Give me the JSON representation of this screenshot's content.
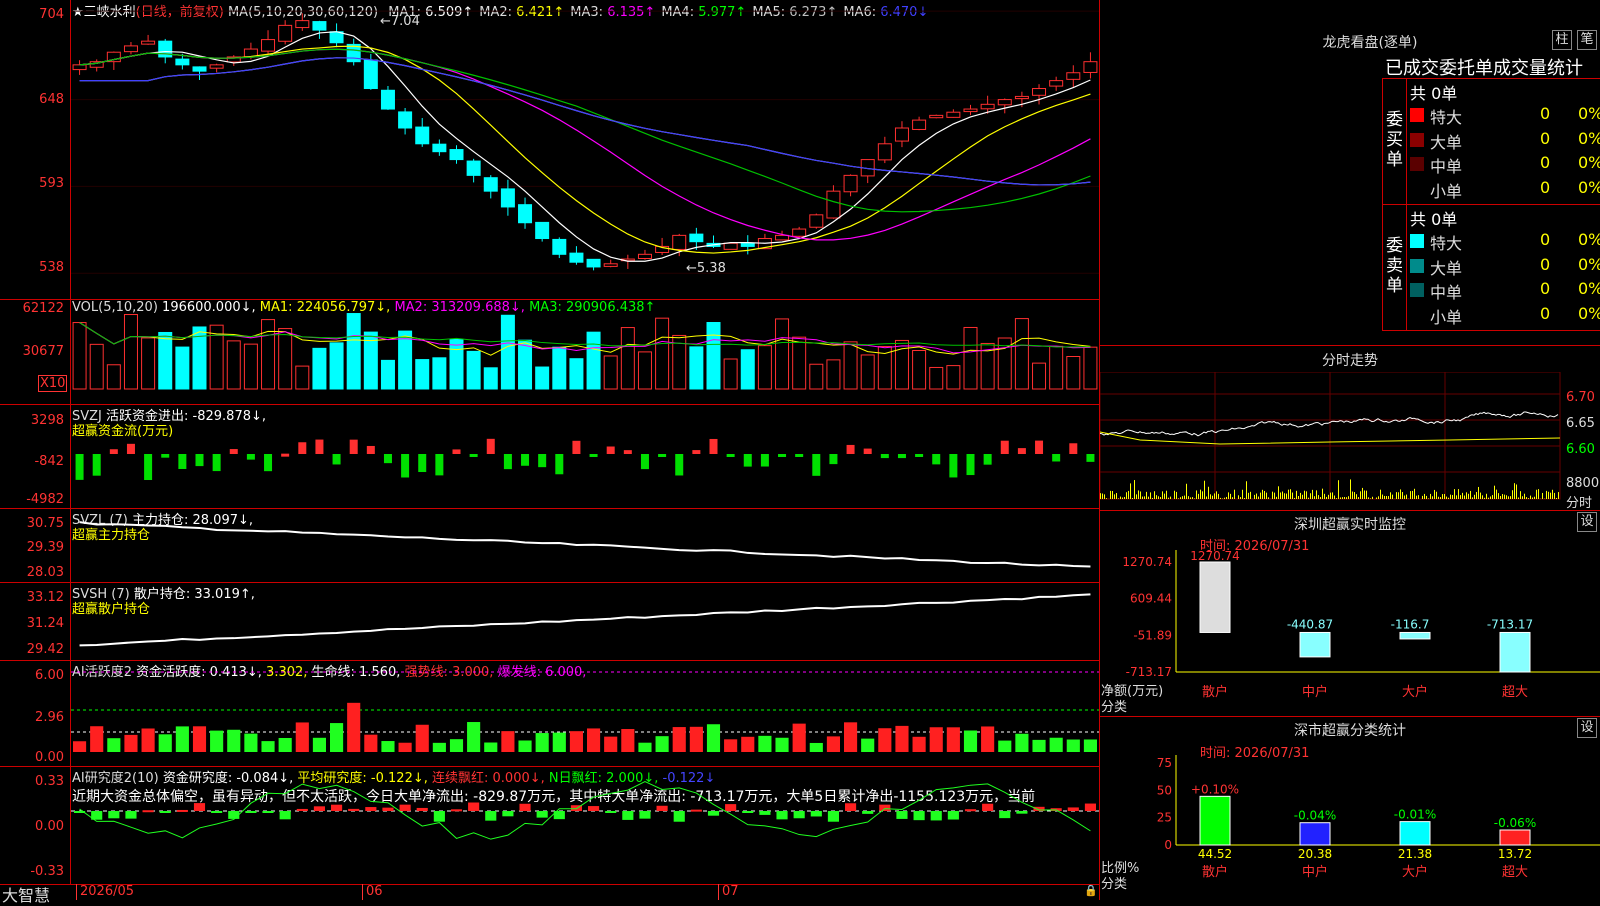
{
  "stock": {
    "title": "★三峡水利",
    "period": "(日线，前复权)",
    "ma_header": "MA(5,10,20,30,60,120)",
    "ma": [
      {
        "label": "MA1:",
        "value": "6.509↑",
        "color": "#ffffff"
      },
      {
        "label": "MA2:",
        "value": "6.421↑",
        "color": "#ffff00"
      },
      {
        "label": "MA3:",
        "value": "6.135↑",
        "color": "#ff00ff"
      },
      {
        "label": "MA4:",
        "value": "5.977↑",
        "color": "#00ff00"
      },
      {
        "label": "MA5:",
        "value": "6.273↑",
        "color": "#c0c0c0"
      },
      {
        "label": "MA6:",
        "value": "6.470↓",
        "color": "#4040ff"
      }
    ],
    "high_label": "7.04",
    "low_label": "5.38",
    "y_ticks": [
      "704",
      "648",
      "593",
      "538"
    ]
  },
  "vol": {
    "header": "VOL(5,10,20)",
    "value": "196600.000↓,",
    "ma1": "MA1: 224056.797↓,",
    "ma2": "MA2: 313209.688↓,",
    "ma3": "MA3: 290906.438↑",
    "y_ticks": [
      "62122",
      "30677"
    ],
    "unit": "X10"
  },
  "svzj": {
    "header": "SVZJ",
    "line1": "活跃资金进出: -829.878↓,",
    "line2": "超赢资金流(万元)",
    "y_ticks": [
      "3298",
      "-842",
      "-4982"
    ]
  },
  "svzl": {
    "header": "SVZL (7)",
    "line1": "主力持仓: 28.097↓,",
    "line2": "超赢主力持仓",
    "y_ticks": [
      "30.75",
      "29.39",
      "28.03"
    ]
  },
  "svsh": {
    "header": "SVSH (7)",
    "line1": "散户持仓: 33.019↑,",
    "line2": "超赢散户持仓",
    "y_ticks": [
      "33.12",
      "31.24",
      "29.42"
    ]
  },
  "ai_active": {
    "header": "AI活跃度2",
    "part1": "资金活跃度: 0.413↓,",
    "part2": "3.302,",
    "part3": "生命线: 1.560,",
    "part4": "强势线: 3.000,",
    "part5": "爆发线: 6.000,",
    "y_ticks": [
      "6.00",
      "2.96",
      "0.00"
    ]
  },
  "ai_research": {
    "header": "AI研究度2(10)",
    "part1": "资金研究度: -0.084↓,",
    "part2": "平均研究度: -0.122↓,",
    "part3": "连续飘红: 0.000↓,",
    "part4": "N日飘红: 2.000↓,",
    "part5": "-0.122↓",
    "note": "近期大资金总体偏空，虽有异动，但不太活跃，今日大单净流出: -829.87万元，其中特大单净流出: -713.17万元，大单5日累计净出-1155.123万元，当前",
    "y_ticks": [
      "0.33",
      "0.00",
      "-0.33"
    ]
  },
  "bottom": {
    "app": "大智慧",
    "dates": [
      "2026/05",
      "06",
      "07"
    ]
  },
  "longhu": {
    "title": "龙虎看盘(逐单)",
    "btn1": "柱",
    "btn2": "笔",
    "subtitle": "已成交委托单成交量统计",
    "buy_label": "委买单",
    "sell_label": "委卖单",
    "buy_total": "共 0单",
    "sell_total": "共 0单",
    "buy_rows": [
      {
        "label": "特大",
        "val": "0",
        "pct": "0%",
        "color": "#ff0000"
      },
      {
        "label": "大单",
        "val": "0",
        "pct": "0%",
        "color": "#8b0000"
      },
      {
        "label": "中单",
        "val": "0",
        "pct": "0%",
        "color": "#5a0000"
      },
      {
        "label": "小单",
        "val": "0",
        "pct": "0%",
        "color": ""
      }
    ],
    "sell_rows": [
      {
        "label": "特大",
        "val": "0",
        "pct": "0%",
        "color": "#00ffff"
      },
      {
        "label": "大单",
        "val": "0",
        "pct": "0%",
        "color": "#008b8b"
      },
      {
        "label": "中单",
        "val": "0",
        "pct": "0%",
        "color": "#006060"
      },
      {
        "label": "小单",
        "val": "0",
        "pct": "0%",
        "color": ""
      }
    ]
  },
  "intraday": {
    "title": "分时走势",
    "y_ticks": [
      "6.70",
      "6.65",
      "6.60"
    ],
    "vol_tick": "8800",
    "vol_label": "分时"
  },
  "monitor": {
    "title": "深圳超赢实时监控",
    "set": "设",
    "time": "时间: 2026/07/31",
    "top_value": "1270.74",
    "y_ticks": [
      "1270.74",
      "609.44",
      "-51.89",
      "-713.17"
    ],
    "y_title": "净额(万元)",
    "x_title": "分类",
    "cats": [
      "散户",
      "中户",
      "大户",
      "超大"
    ],
    "values": [
      1270.74,
      -440.87,
      -116.7,
      -713.17
    ],
    "value_labels": [
      "1270.74",
      "-440.87",
      "-116.7",
      "-713.17"
    ]
  },
  "classify": {
    "title": "深市超赢分类统计",
    "set": "设",
    "time": "时间: 2026/07/31",
    "y_ticks": [
      "75",
      "50",
      "25",
      "0"
    ],
    "y_title": "比例%",
    "x_title": "分类",
    "cats": [
      "散户",
      "中户",
      "大户",
      "超大"
    ],
    "values": [
      44.52,
      20.38,
      21.38,
      13.72
    ],
    "changes": [
      "+0.10%",
      "-0.04%",
      "-0.01%",
      "-0.06%"
    ]
  },
  "colors": {
    "up": "#ff3030",
    "down": "#00ffff",
    "grid": "#c00000"
  }
}
